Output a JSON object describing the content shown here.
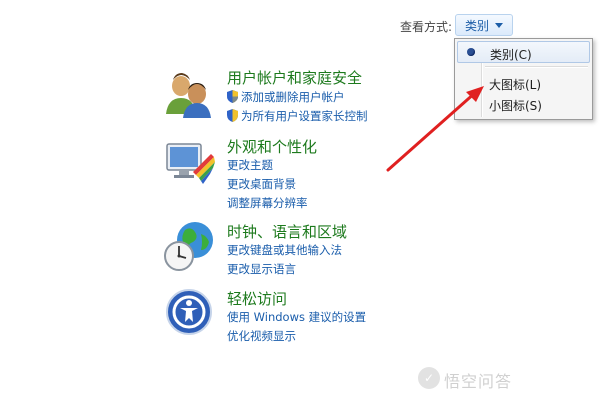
{
  "view_by": {
    "label": "查看方式:",
    "selected": "类别"
  },
  "menu": {
    "items": [
      {
        "label": "类别(C)",
        "selected": true
      },
      {
        "label": "大图标(L)",
        "selected": false
      },
      {
        "label": "小图标(S)",
        "selected": false
      }
    ]
  },
  "categories": [
    {
      "title": "用户帐户和家庭安全",
      "icon": "users-icon",
      "links": [
        "添加或删除用户帐户",
        "为所有用户设置家长控制"
      ]
    },
    {
      "title": "外观和个性化",
      "icon": "appearance-icon",
      "links": [
        "更改主题",
        "更改桌面背景",
        "调整屏幕分辨率"
      ]
    },
    {
      "title": "时钟、语言和区域",
      "icon": "clock-globe-icon",
      "links": [
        "更改键盘或其他输入法",
        "更改显示语言"
      ]
    },
    {
      "title": "轻松访问",
      "icon": "ease-of-access-icon",
      "links": [
        "使用 Windows 建议的设置",
        "优化视频显示"
      ]
    }
  ],
  "annotation": {
    "color": "#e02020"
  },
  "watermark": {
    "text": "悟空问答"
  },
  "colors": {
    "title_green": "#1d7a1d",
    "link_blue": "#1a5dab"
  }
}
